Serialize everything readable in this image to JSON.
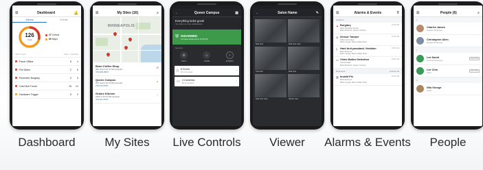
{
  "cards": {
    "dashboard": {
      "caption": "Dashboard",
      "title": "Dashboard",
      "tabs": [
        "Alarms",
        "Events"
      ],
      "total": "126",
      "total_label": "Total",
      "legend": [
        {
          "value": "37",
          "label": "Critical",
          "color": "#d9362b"
        },
        {
          "value": "89",
          "label": "Major",
          "color": "#f29a1f"
        }
      ],
      "columns": [
        "Alarm Types",
        "Today",
        "Yesterday"
      ],
      "rows": [
        {
          "name": "Panel Offline",
          "today": "8",
          "yesterday": "4",
          "color": "#d9362b"
        },
        {
          "name": "Fire Alarm",
          "today": "2",
          "yesterday": "6",
          "color": "#d9362b"
        },
        {
          "name": "Perimeter Burglary",
          "today": "9",
          "yesterday": "5",
          "color": "#d9362b"
        },
        {
          "name": "Card Not Found",
          "today": "18",
          "yesterday": "12",
          "color": "#d9362b"
        },
        {
          "name": "Hardware Trigger",
          "today": "8",
          "yesterday": "3",
          "color": "#f29a1f"
        }
      ]
    },
    "mysites": {
      "caption": "My Sites",
      "title": "My Sites (16)",
      "map_label": "MINNEAPOLIS",
      "sites": [
        {
          "name": "Bean Coffee Shop",
          "address": "682 South 4th St Minneapolis",
          "phone": "763-948-9863"
        },
        {
          "name": "Queen Campus",
          "address": "602 South 4th St Minneapolis",
          "phone": "795-512-8791"
        },
        {
          "name": "Grains Kitchen",
          "address": "2405 S 4th St Minneapolis",
          "phone": "763-512-8701"
        }
      ]
    },
    "live": {
      "caption": "Live Controls",
      "title": "Queen Campus",
      "banner_title": "Everything looks good!",
      "banner_sub": "You have no new notifications",
      "status": "DISARMED",
      "status_sub": "All areas Disarmed at 11:05 PM",
      "section": "Security",
      "modes": [
        "AWAY",
        "HOME",
        "DISARM"
      ],
      "rows": [
        {
          "title": "8 Doors",
          "sub": "All Connected"
        },
        {
          "title": "4 Cameras",
          "sub": "All Connected"
        }
      ]
    },
    "viewer": {
      "caption": "Viewer",
      "title": "Salon Name",
      "cams": [
        "Main Ent",
        "Main Ent Cam",
        "Cam Ent",
        "Main Ent",
        "Main Ent Cam",
        "Studio Cam"
      ]
    },
    "alarms": {
      "caption": "Alarms & Events",
      "title": "Alarms & Events",
      "section_alarms": "6 Alarms",
      "alarms": [
        {
          "title": "Burglary",
          "sub": "West Driveway Sensor",
          "loc": "Main Entrance, Queen Campus",
          "time": "10:05 AM"
        },
        {
          "title": "Sensor Tamper",
          "sub": "Office Front Door",
          "loc": "Main Lounge, Bean Coffee Shop",
          "time": "10:06 AM"
        },
        {
          "title": "Hard Anti-passback Violation",
          "sub": "Main Entrance",
          "loc": "Main Lounge, Bean Coffee Shop",
          "time": "10:06 AM"
        },
        {
          "title": "Video Motion Detection",
          "sub": "Camera Mall",
          "loc": "Main Entrance, Queen Campus",
          "time": "10:06 AM"
        }
      ],
      "section_events": "84 Events",
      "archive": "Archive All",
      "events": [
        {
          "title": "Invalid Pin",
          "sub": "Main Entrance",
          "loc": "Main Lounge, Bean Coffee Shop",
          "time": "10:06 AM"
        }
      ]
    },
    "people": {
      "caption": "People",
      "title": "People (6)",
      "groups": [
        {
          "letter": "C",
          "people": [
            {
              "name": "Charles James",
              "role": "Regular Employee",
              "badge": "",
              "color": "#b98b6e"
            },
            {
              "name": "Christopher Allen",
              "role": "Regular Employee",
              "badge": "",
              "color": "#7d8fa3"
            }
          ]
        },
        {
          "letter": "L",
          "people": [
            {
              "name": "Lee David",
              "role": "Contract Employee",
              "badge": "INACTIVE",
              "color": "#3a9a5a"
            },
            {
              "name": "Lee Chin",
              "role": "Other",
              "badge": "INACTIVE",
              "color": "#3a9a5a"
            }
          ]
        },
        {
          "letter": "N",
          "people": [
            {
              "name": "Nilo George",
              "role": "Visitor",
              "badge": "",
              "color": "#a8865f"
            }
          ]
        }
      ]
    }
  }
}
